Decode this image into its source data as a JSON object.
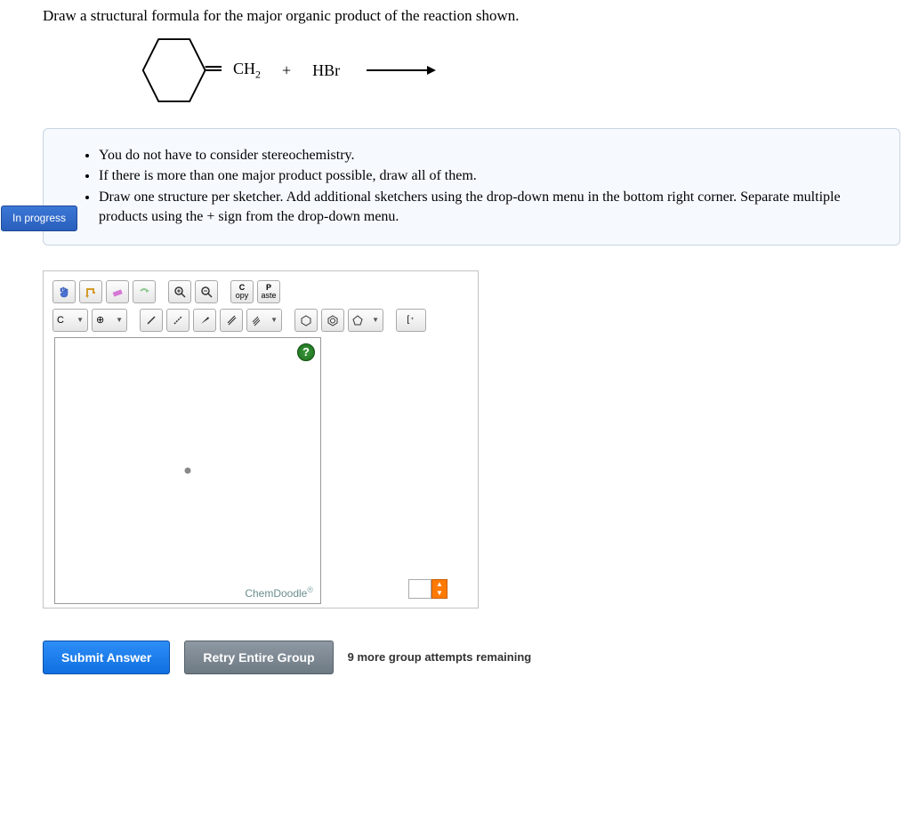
{
  "question": {
    "title": "Draw a structural formula for the major organic product of the reaction shown.",
    "reagent_ch2": "CH",
    "reagent_ch2_sub": "2",
    "plus": "+",
    "reagent_hbr": "HBr"
  },
  "instructions": {
    "items": [
      "You do not have to consider stereochemistry.",
      "If there is more than one major product possible, draw all of them.",
      "Draw one structure per sketcher. Add additional sketchers using the drop-down menu in the bottom right corner. Separate multiple products using the + sign from the drop-down menu."
    ],
    "status_badge": "In progress"
  },
  "toolbar": {
    "copy": "C",
    "copy_sub": "opy",
    "paste": "P",
    "paste_sub": "aste",
    "element_c": "C",
    "bracket": "[ ]"
  },
  "sketcher": {
    "brand": "ChemDoodle",
    "help": "?"
  },
  "actions": {
    "submit": "Submit Answer",
    "retry": "Retry Entire Group",
    "attempts": "9 more group attempts remaining"
  }
}
